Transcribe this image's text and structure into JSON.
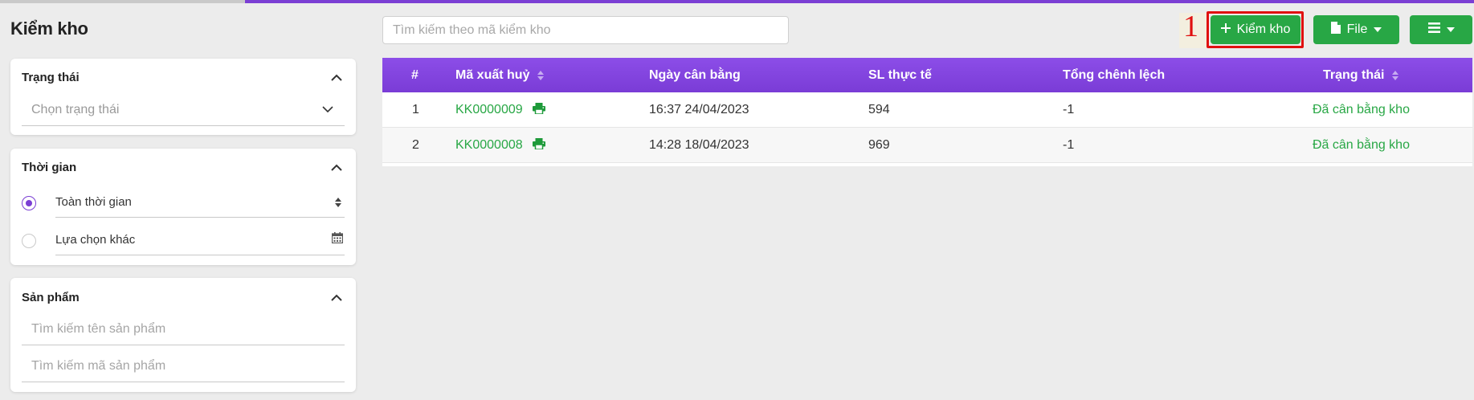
{
  "page": {
    "title": "Kiểm kho"
  },
  "filters": {
    "status": {
      "title": "Trạng thái",
      "placeholder": "Chọn trạng thái"
    },
    "time": {
      "title": "Thời gian",
      "options": [
        {
          "label": "Toàn thời gian",
          "selected": true
        },
        {
          "label": "Lựa chọn khác",
          "selected": false
        }
      ]
    },
    "product": {
      "title": "Sản phẩm",
      "name_placeholder": "Tìm kiếm tên sản phẩm",
      "code_placeholder": "Tìm kiếm mã sản phẩm"
    }
  },
  "search": {
    "placeholder": "Tìm kiếm theo mã kiểm kho"
  },
  "annotation": {
    "number": "1"
  },
  "toolbar": {
    "add_label": "Kiểm kho",
    "file_label": "File"
  },
  "table": {
    "columns": [
      "#",
      "Mã xuất huỷ",
      "Ngày cân bằng",
      "SL thực tế",
      "Tổng chênh lệch",
      "Trạng thái"
    ],
    "rows": [
      {
        "index": "1",
        "code": "KK0000009",
        "date": "16:37 24/04/2023",
        "actual_qty": "594",
        "total_diff": "-1",
        "status": "Đã cân bằng kho"
      },
      {
        "index": "2",
        "code": "KK0000008",
        "date": "14:28 18/04/2023",
        "actual_qty": "969",
        "total_diff": "-1",
        "status": "Đã cân bằng kho"
      }
    ]
  },
  "colors": {
    "accent": "#7b3fd4",
    "success": "#28a745",
    "annotation": "#e01010"
  }
}
